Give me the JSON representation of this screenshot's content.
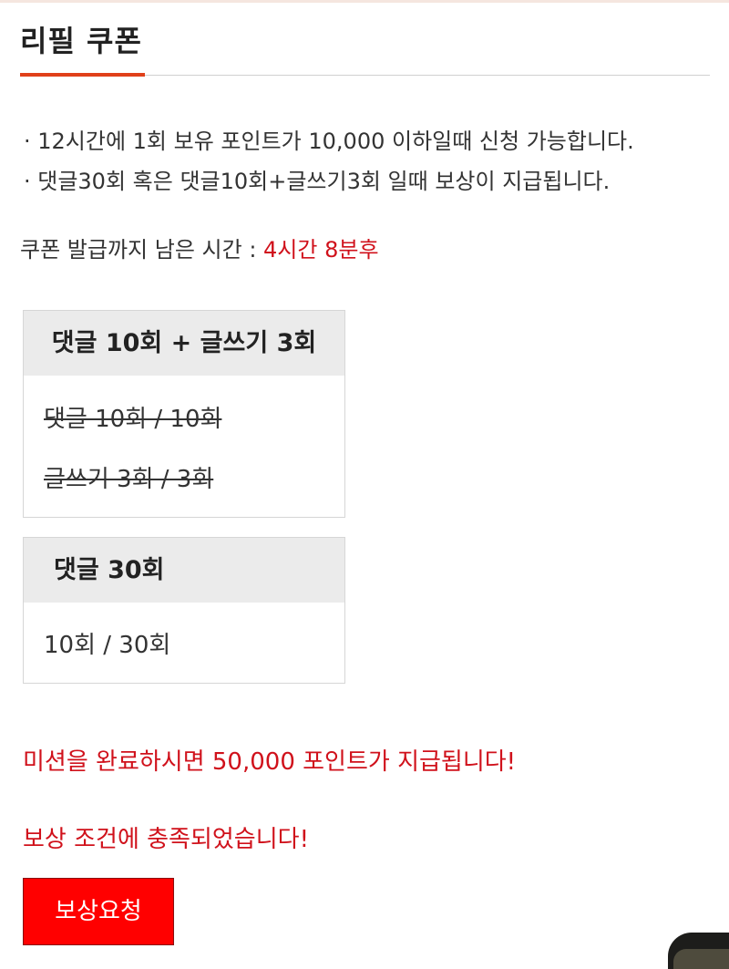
{
  "header": {
    "title": "리필 쿠폰"
  },
  "notes": [
    "· 12시간에 1회 보유 포인트가 10,000 이하일때 신청 가능합니다.",
    "· 댓글30회 혹은 댓글10회+글쓰기3회 일때 보상이 지급됩니다."
  ],
  "countdown": {
    "label": "쿠폰 발급까지 남은 시간 : ",
    "value": "4시간 8분후"
  },
  "mission_a": {
    "title": "댓글 10회 + 글쓰기 3회",
    "rows": [
      "댓글 10회 / 10회",
      "글쓰기 3회 / 3회"
    ]
  },
  "mission_b": {
    "title": "댓글 30회",
    "rows": [
      "10회 / 30회"
    ]
  },
  "messages": {
    "reward_info": "미션을 완료하시면 50,000 포인트가 지급됩니다!",
    "condition_met": "보상 조건에 충족되었습니다!"
  },
  "button": {
    "label": "보상요청"
  },
  "colors": {
    "accent": "#e0401a",
    "alert": "#d0111b",
    "button": "#ff0000"
  }
}
